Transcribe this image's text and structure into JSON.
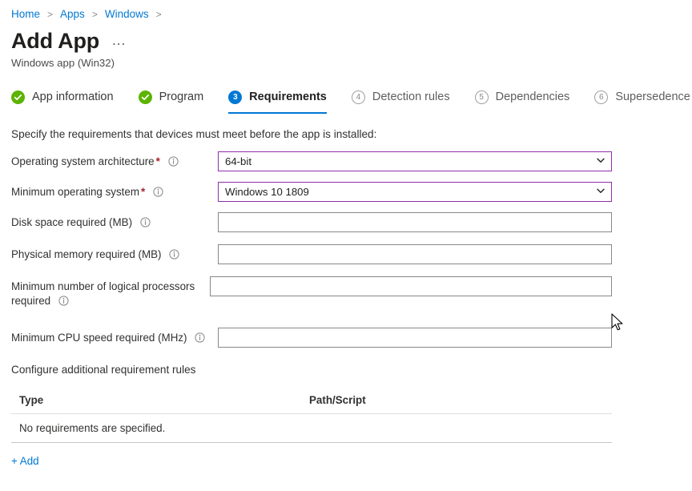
{
  "breadcrumb": {
    "items": [
      "Home",
      "Apps",
      "Windows"
    ],
    "separator": ">"
  },
  "header": {
    "title": "Add App",
    "more_label": "...",
    "subtitle": "Windows app (Win32)"
  },
  "wizard": {
    "tabs": [
      {
        "label": "App information",
        "state": "done",
        "number": "1",
        "mark": "check-icon"
      },
      {
        "label": "Program",
        "state": "done",
        "number": "2",
        "mark": "check-icon"
      },
      {
        "label": "Requirements",
        "state": "current",
        "number": "3",
        "mark": "3"
      },
      {
        "label": "Detection rules",
        "state": "pending",
        "number": "4",
        "mark": "4"
      },
      {
        "label": "Dependencies",
        "state": "pending",
        "number": "5",
        "mark": "5"
      },
      {
        "label": "Supersedence (preview)",
        "state": "pending",
        "number": "6",
        "mark": "6"
      }
    ]
  },
  "form": {
    "intro": "Specify the requirements that devices must meet before the app is installed:",
    "fields": [
      {
        "label": "Operating system architecture",
        "required": true,
        "star": "*",
        "info": "info-icon",
        "control": "select",
        "value": "64-bit",
        "placeholder": ""
      },
      {
        "label": "Minimum operating system",
        "required": true,
        "star": "*",
        "info": "info-icon",
        "control": "select",
        "value": "Windows 10 1809",
        "placeholder": ""
      },
      {
        "label": "Disk space required (MB)",
        "required": false,
        "star": "",
        "info": "info-icon",
        "control": "text",
        "value": "",
        "placeholder": ""
      },
      {
        "label": "Physical memory required (MB)",
        "required": false,
        "star": "",
        "info": "info-icon",
        "control": "text",
        "value": "",
        "placeholder": ""
      },
      {
        "label": "Minimum number of logical processors required",
        "required": false,
        "star": "",
        "info": "info-icon",
        "control": "text",
        "value": "",
        "placeholder": ""
      },
      {
        "label": "Minimum CPU speed required (MHz)",
        "required": false,
        "star": "",
        "info": "info-icon",
        "control": "text",
        "value": "",
        "placeholder": ""
      }
    ]
  },
  "rules": {
    "section_label": "Configure additional requirement rules",
    "columns": [
      "Type",
      "Path/Script"
    ],
    "empty_message": "No requirements are specified.",
    "add_label": "+ Add"
  },
  "colors": {
    "link": "#0078d4",
    "accent": "#0078d4",
    "success": "#5cb300",
    "required_star": "#a4262c",
    "select_border": "#8f2eac",
    "input_border": "#8a8886"
  }
}
